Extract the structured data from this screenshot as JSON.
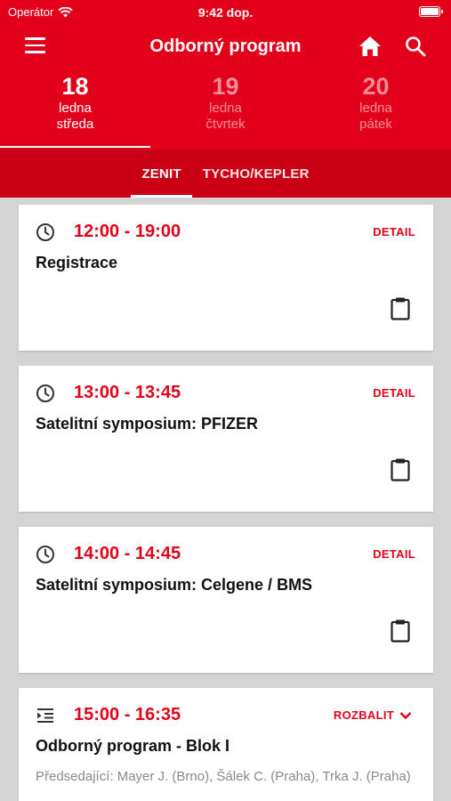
{
  "status": {
    "carrier": "Operátor",
    "time": "9:42 dop."
  },
  "appbar": {
    "title": "Odborný program"
  },
  "days": [
    {
      "num": "18",
      "month": "ledna",
      "weekday": "středa",
      "active": true
    },
    {
      "num": "19",
      "month": "ledna",
      "weekday": "čtvrtek",
      "active": false
    },
    {
      "num": "20",
      "month": "ledna",
      "weekday": "pátek",
      "active": false
    }
  ],
  "halls": [
    {
      "label": "ZENIT",
      "active": true
    },
    {
      "label": "TYCHO/KEPLER",
      "active": false
    }
  ],
  "sessions": [
    {
      "time": "12:00 - 19:00",
      "title": "Registrace",
      "action": "DETAIL"
    },
    {
      "time": "13:00 - 13:45",
      "title": "Satelitní symposium: PFIZER",
      "action": "DETAIL"
    },
    {
      "time": "14:00 - 14:45",
      "title": "Satelitní symposium: Celgene / BMS",
      "action": "DETAIL"
    },
    {
      "time": "15:00 - 16:35",
      "title": "Odborný program - Blok I",
      "action": "ROZBALIT",
      "chairs": "Předsedající: Mayer J. (Brno), Šálek C. (Praha), Trka J. (Praha)"
    }
  ],
  "colors": {
    "brand": "#e2001a",
    "brand_dark": "#cc0015",
    "background": "#d4d4d4"
  }
}
